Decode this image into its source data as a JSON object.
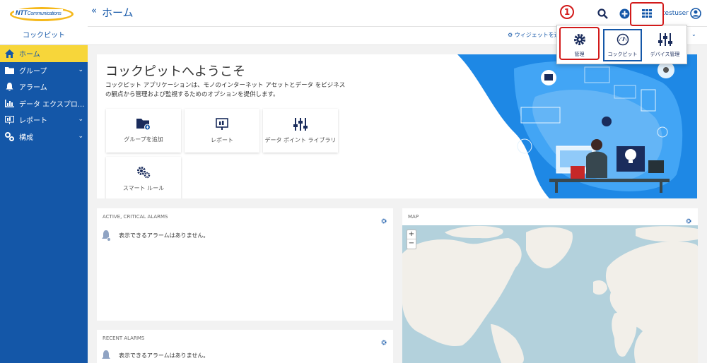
{
  "brand": {
    "logo_main": "NTT",
    "logo_sub": "Communications",
    "app_name": "コックピット"
  },
  "header": {
    "title": "ホーム",
    "username": "testuser"
  },
  "subbar": {
    "add_widget": "ウィジェットを追"
  },
  "sidebar": {
    "items": [
      {
        "label": "ホーム",
        "icon": "home-icon",
        "active": true
      },
      {
        "label": "グループ",
        "icon": "folder-icon",
        "expandable": true
      },
      {
        "label": "アラーム",
        "icon": "bell-icon"
      },
      {
        "label": "データ エクスプロ...",
        "icon": "chart-icon"
      },
      {
        "label": "レポート",
        "icon": "report-icon",
        "expandable": true
      },
      {
        "label": "構成",
        "icon": "config-icon",
        "expandable": true
      }
    ]
  },
  "welcome": {
    "title": "コックピットへようこそ",
    "description": "コックピット アプリケーションは、モノのインターネット アセットとデータ をビジネスの観点から管理および監視するためのオプションを提供します。",
    "tiles": [
      {
        "label": "グループを追加",
        "icon": "folder-add-icon"
      },
      {
        "label": "レポート",
        "icon": "report-icon"
      },
      {
        "label": "データ ポイント ライブラリ",
        "icon": "sliders-icon"
      },
      {
        "label": "スマート ルール",
        "icon": "gears-icon"
      }
    ]
  },
  "alarms_active": {
    "title": "ACTIVE, CRITICAL ALARMS",
    "empty": "表示できるアラームはありません。"
  },
  "alarms_recent": {
    "title": "RECENT ALARMS",
    "empty": "表示できるアラームはありません。"
  },
  "map": {
    "title": "MAP",
    "zoom_in": "+",
    "zoom_out": "−"
  },
  "app_switcher": {
    "apps": [
      {
        "label": "管理",
        "icon": "gear-icon",
        "highlighted": true
      },
      {
        "label": "コックピット",
        "icon": "gauge-icon",
        "selected": true
      },
      {
        "label": "デバイス管理",
        "icon": "device-icon"
      }
    ]
  },
  "annotation": {
    "step": "1",
    "color": "#d21a1a"
  },
  "colors": {
    "primary": "#1457a8",
    "active_nav": "#f7d63a",
    "highlight": "#d21a1a"
  }
}
